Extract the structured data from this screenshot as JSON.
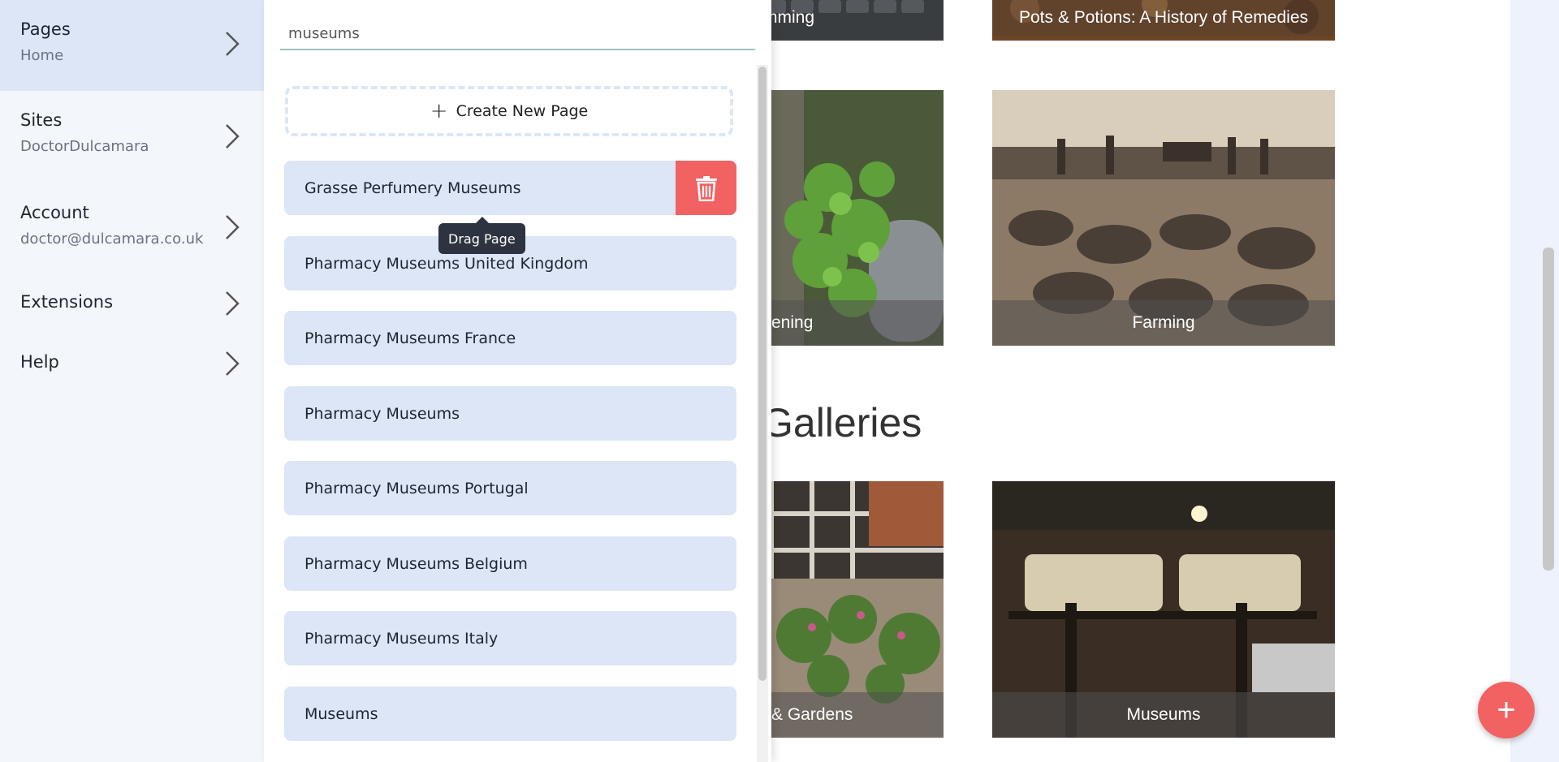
{
  "nav": {
    "items": [
      {
        "title": "Pages",
        "subtitle": "Home"
      },
      {
        "title": "Sites",
        "subtitle": "DoctorDulcamara"
      },
      {
        "title": "Account",
        "subtitle": "doctor@dulcamara.co.uk"
      },
      {
        "title": "Extensions",
        "subtitle": ""
      },
      {
        "title": "Help",
        "subtitle": ""
      }
    ]
  },
  "panel": {
    "search_value": "museums",
    "create_label": "Create New Page",
    "create_icon": "plus-icon",
    "pages": [
      "Grasse Perfumery Museums",
      "Pharmacy Museums United Kingdom",
      "Pharmacy Museums France",
      "Pharmacy Museums",
      "Pharmacy Museums Portugal",
      "Pharmacy Museums Belgium",
      "Pharmacy Museums Italy",
      "Museums"
    ],
    "delete_icon": "trash-icon",
    "tooltip": "Drag Page"
  },
  "content": {
    "tiles": [
      {
        "caption": "mming"
      },
      {
        "caption": "Pots & Potions: A History of Remedies"
      },
      {
        "caption": "ening"
      },
      {
        "caption": "Farming"
      },
      {
        "caption": "& Gardens"
      },
      {
        "caption": "Museums"
      }
    ],
    "section_heading": "Galleries",
    "fab_label": "+"
  },
  "colors": {
    "accent": "#f26262",
    "item_bg": "#dce6f7",
    "nav_bg": "#f3f6fb"
  }
}
